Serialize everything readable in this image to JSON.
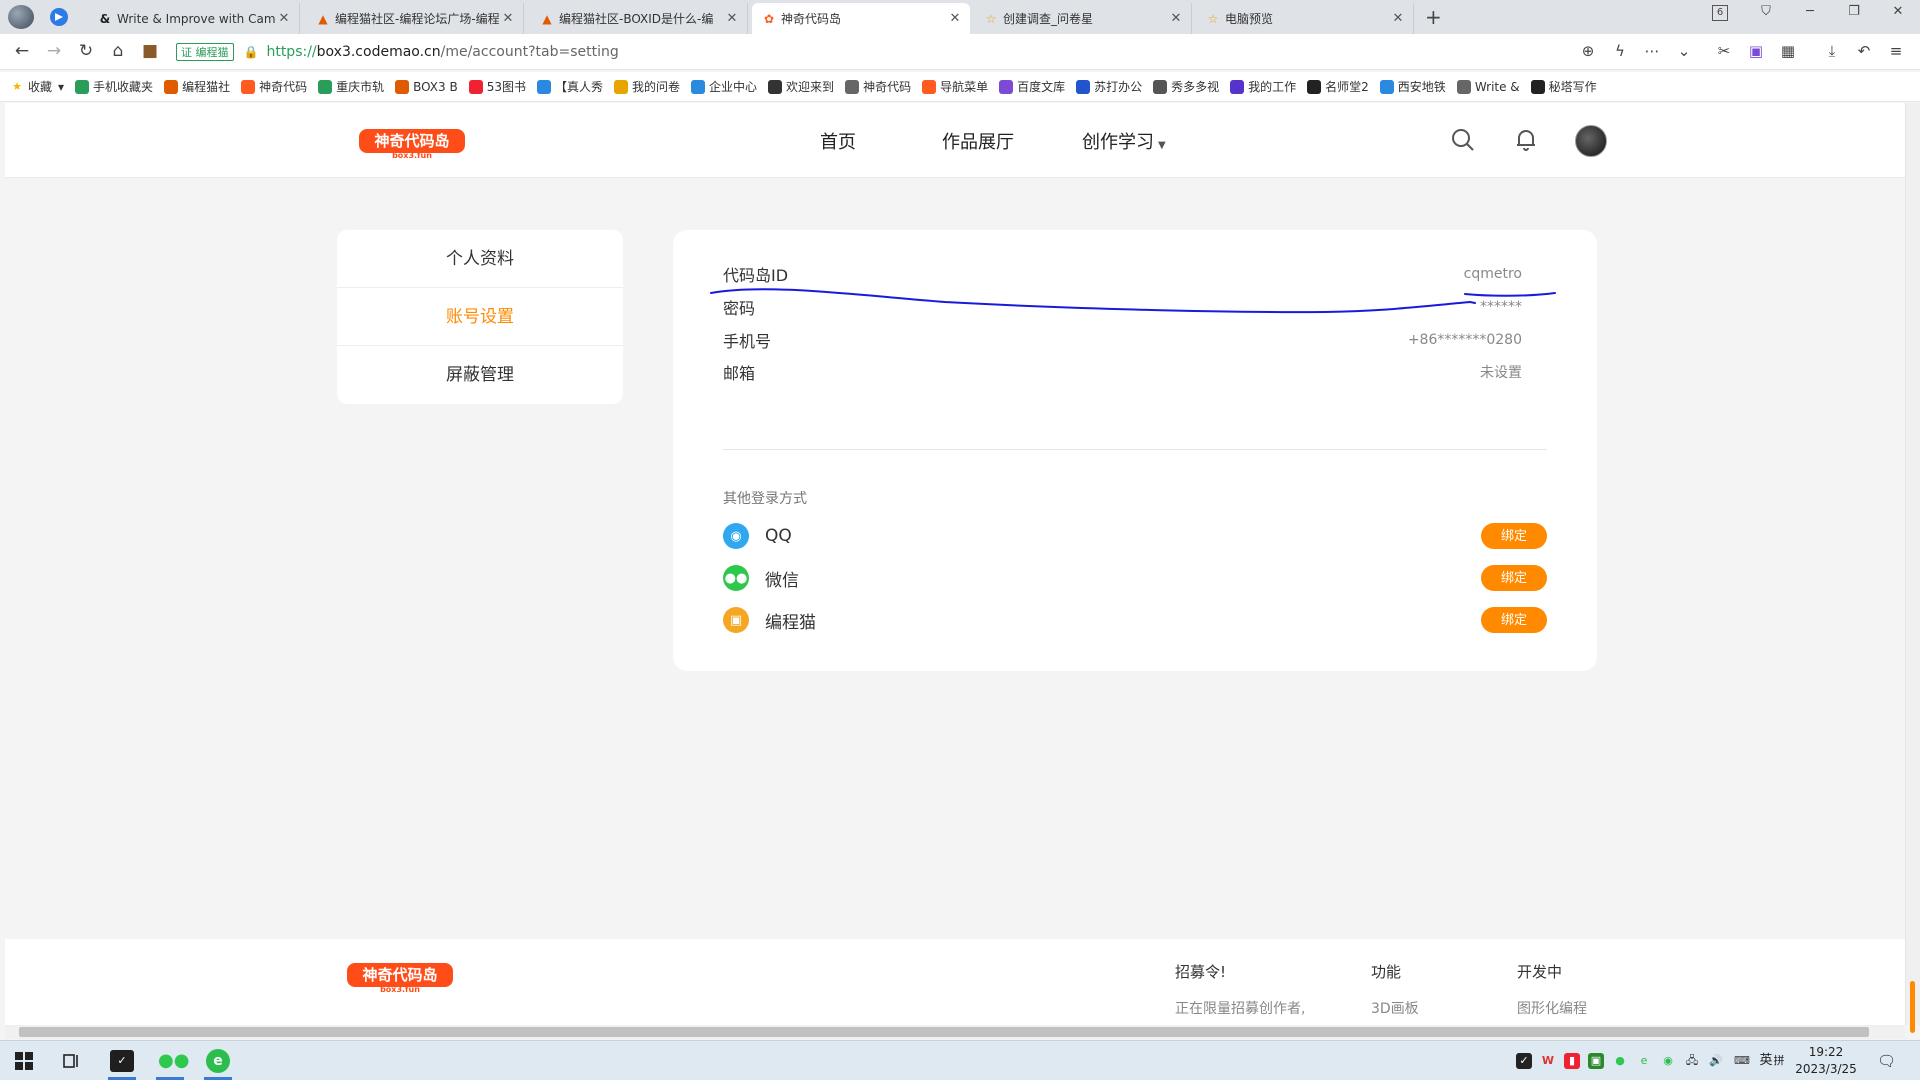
{
  "browser": {
    "tabs": [
      {
        "title": "Write & Improve with Camb",
        "icon": "write-icon",
        "active": false
      },
      {
        "title": "编程猫社区-编程论坛广场-编程",
        "icon": "codemao-icon",
        "active": false
      },
      {
        "title": "编程猫社区-BOXID是什么-编",
        "icon": "codemao-icon",
        "active": false
      },
      {
        "title": "神奇代码岛",
        "icon": "box3-icon",
        "active": true
      },
      {
        "title": "创建调查_问卷星",
        "icon": "star-icon",
        "active": false
      },
      {
        "title": "电脑预览",
        "icon": "star-icon",
        "active": false
      }
    ],
    "tab_count": "6",
    "site_badge": "编程猫",
    "url": {
      "scheme": "https://",
      "host": "box3.codemao.cn",
      "path": "/me/account?tab=setting"
    },
    "bookmarks": [
      "收藏",
      "手机收藏夹",
      "编程猫社",
      "神奇代码",
      "重庆市轨",
      "BOX3 B",
      "53图书",
      "【真人秀",
      "我的问卷",
      "企业中心",
      "欢迎来到",
      "神奇代码",
      "导航菜单",
      "百度文库",
      "苏打办公",
      "秀多多视",
      "我的工作",
      "名师堂2",
      "西安地铁",
      "Write &",
      "秘塔写作"
    ]
  },
  "site": {
    "logo_text": "神奇代码岛",
    "logo_sub": "box3.fun",
    "nav": [
      "首页",
      "作品展厅",
      "创作学习"
    ]
  },
  "side_menu": [
    {
      "label": "个人资料",
      "active": false
    },
    {
      "label": "账号设置",
      "active": true
    },
    {
      "label": "屏蔽管理",
      "active": false
    }
  ],
  "account": {
    "rows": [
      {
        "label": "代码岛ID",
        "value": "cqmetro"
      },
      {
        "label": "密码",
        "value": "******"
      },
      {
        "label": "手机号",
        "value": "+86*******0280"
      },
      {
        "label": "邮箱",
        "value": "未设置"
      }
    ],
    "other_title": "其他登录方式",
    "logins": [
      {
        "name": "QQ",
        "button": "绑定",
        "color": "#2fa8f0",
        "icon": "qq-icon"
      },
      {
        "name": "微信",
        "button": "绑定",
        "color": "#2dc84d",
        "icon": "wechat-icon"
      },
      {
        "name": "编程猫",
        "button": "绑定",
        "color": "#f5a623",
        "icon": "codemao-icon"
      }
    ]
  },
  "footer": {
    "columns": [
      {
        "head": "招募令!",
        "item": "正在限量招募创作者,"
      },
      {
        "head": "功能",
        "item": "3D画板"
      },
      {
        "head": "开发中",
        "item": "图形化编程"
      }
    ]
  },
  "taskbar": {
    "time": "19:22",
    "date": "2023/3/25",
    "ime": "英",
    "ime2": "拼"
  },
  "colors": {
    "accent": "#ff8a00",
    "annotation": "#1a1adc"
  }
}
